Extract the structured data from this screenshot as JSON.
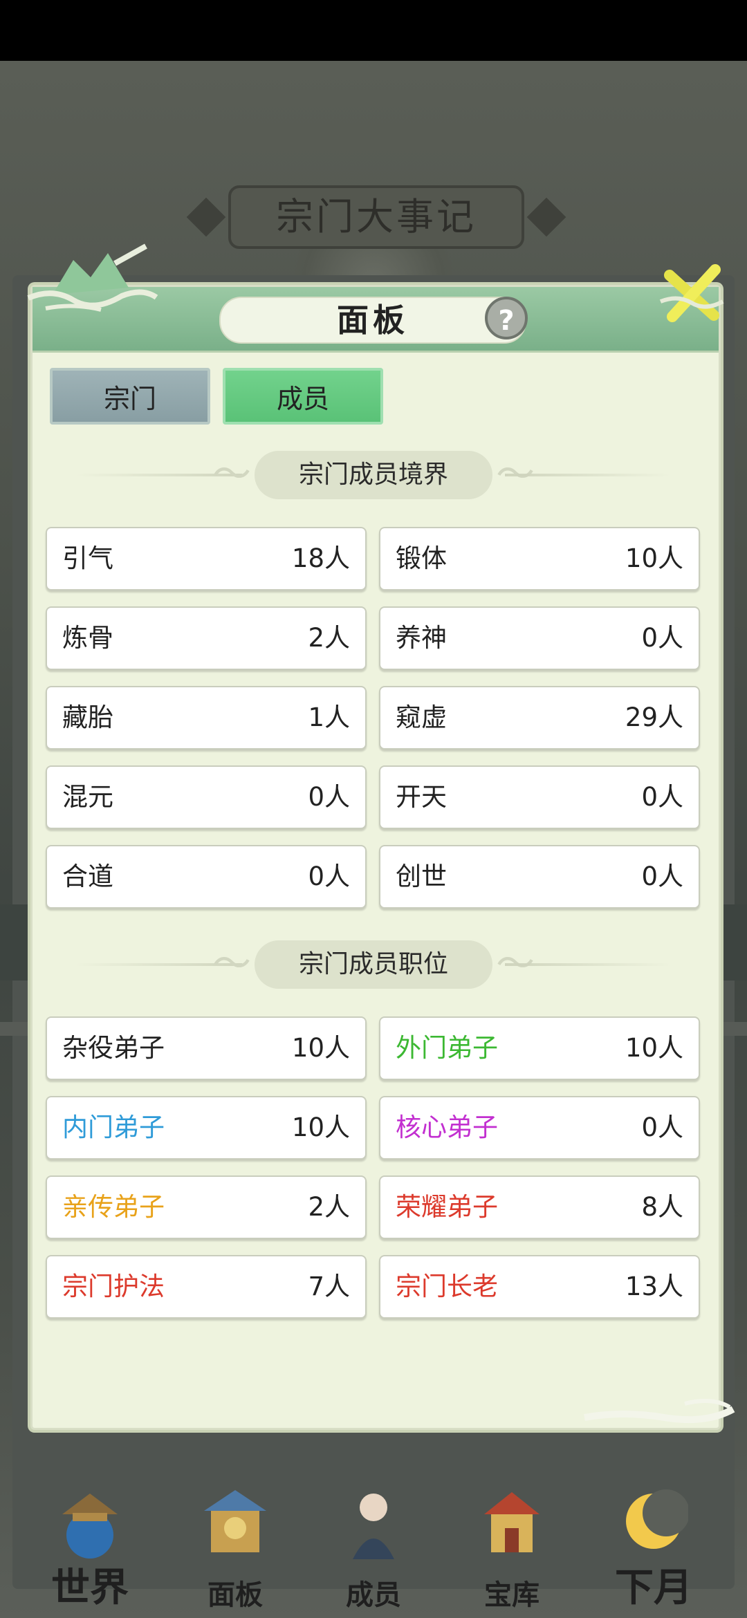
{
  "background": {
    "event_title": "宗门大事记"
  },
  "panel": {
    "title": "面板",
    "help_glyph": "?",
    "tabs": [
      {
        "label": "宗门",
        "active": false
      },
      {
        "label": "成员",
        "active": true
      }
    ],
    "realm_section": {
      "title": "宗门成员境界",
      "items": [
        {
          "name": "引气",
          "count": "18人"
        },
        {
          "name": "锻体",
          "count": "10人"
        },
        {
          "name": "炼骨",
          "count": "2人"
        },
        {
          "name": "养神",
          "count": "0人"
        },
        {
          "name": "藏胎",
          "count": "1人"
        },
        {
          "name": "窥虚",
          "count": "29人"
        },
        {
          "name": "混元",
          "count": "0人"
        },
        {
          "name": "开天",
          "count": "0人"
        },
        {
          "name": "合道",
          "count": "0人"
        },
        {
          "name": "创世",
          "count": "0人"
        }
      ]
    },
    "position_section": {
      "title": "宗门成员职位",
      "items": [
        {
          "name": "杂役弟子",
          "count": "10人",
          "color": "#222222"
        },
        {
          "name": "外门弟子",
          "count": "10人",
          "color": "#3cb832"
        },
        {
          "name": "内门弟子",
          "count": "10人",
          "color": "#2f9bd8"
        },
        {
          "name": "核心弟子",
          "count": "0人",
          "color": "#c22fd0"
        },
        {
          "name": "亲传弟子",
          "count": "2人",
          "color": "#e8a21a"
        },
        {
          "name": "荣耀弟子",
          "count": "8人",
          "color": "#dc3a2c"
        },
        {
          "name": "宗门护法",
          "count": "7人",
          "color": "#dc3a2c"
        },
        {
          "name": "宗门长老",
          "count": "13人",
          "color": "#dc3a2c"
        }
      ]
    }
  },
  "bottom_nav": [
    {
      "label": "世界",
      "icon": "world-palace-icon"
    },
    {
      "label": "面板",
      "icon": "panel-gate-icon"
    },
    {
      "label": "成员",
      "icon": "member-figure-icon"
    },
    {
      "label": "宝库",
      "icon": "treasury-icon"
    },
    {
      "label": "下月",
      "icon": "moon-icon"
    }
  ],
  "colors": {
    "panel_bg": "#eef3de",
    "header_green": "#7ab089",
    "active_tab": "#5ac277",
    "inactive_tab": "#889ea3"
  }
}
